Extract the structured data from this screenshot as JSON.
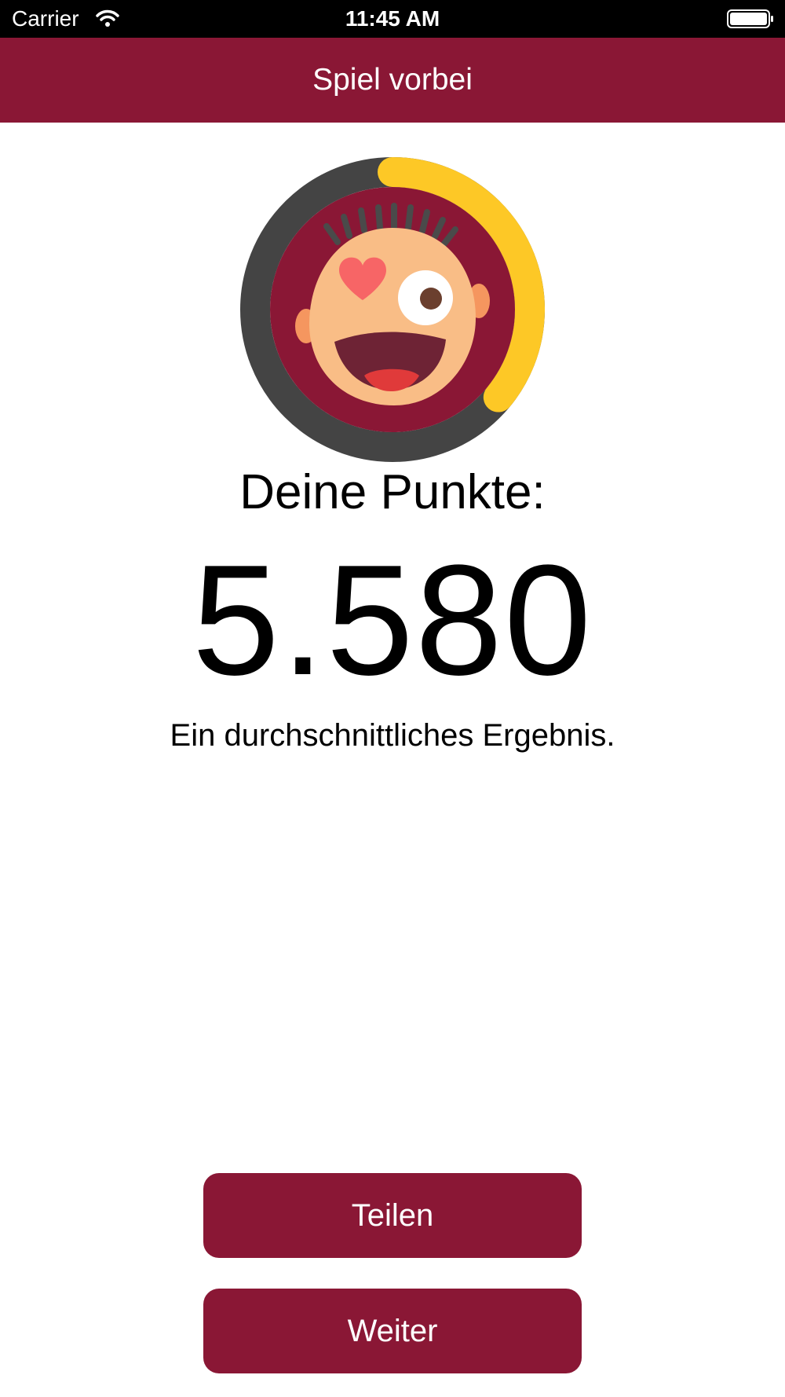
{
  "status_bar": {
    "carrier": "Carrier",
    "time": "11:45 AM"
  },
  "nav": {
    "title": "Spiel vorbei"
  },
  "avatar": {
    "icon": "happy-face-heart-eye-icon",
    "progress_fraction": 0.36
  },
  "score": {
    "heading": "Deine Punkte:",
    "value": "5.580",
    "comment": "Ein durchschnittliches Ergebnis."
  },
  "buttons": {
    "share_label": "Teilen",
    "next_label": "Weiter"
  },
  "colors": {
    "brand": "#8a1735",
    "ring_track": "#444444",
    "ring_progress": "#fdc826",
    "face_skin": "#f9bd86",
    "heart": "#f76566"
  }
}
